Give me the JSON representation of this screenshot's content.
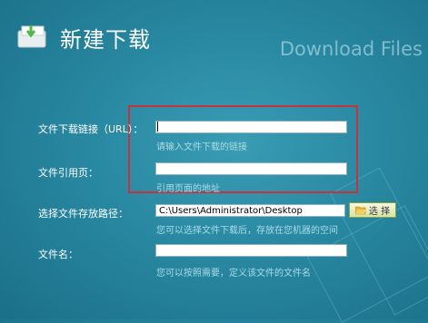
{
  "header": {
    "title": "新建下载",
    "subtitle": "Download Files"
  },
  "form": {
    "url": {
      "label": "文件下载链接（URL）：",
      "value": "",
      "hint": "请输入文件下载的链接"
    },
    "referrer": {
      "label": "文件引用页：",
      "value": "",
      "hint": "引用页面的地址"
    },
    "save_path": {
      "label": "选择文件存放路径：",
      "value": "C:\\Users\\Administrator\\Desktop",
      "hint": "您可以选择文件下载后，存放在您机器的空间",
      "browse_label": "选 择"
    },
    "filename": {
      "label": "文件名：",
      "value": "",
      "hint": "您可以按照需要，定义该文件的文件名"
    }
  },
  "icons": {
    "title_icon": "download-folder-icon",
    "browse_icon": "folder-icon"
  },
  "colors": {
    "background": "#2a8aa3",
    "highlight": "#c8323c",
    "hint": "#a9dbe8"
  }
}
